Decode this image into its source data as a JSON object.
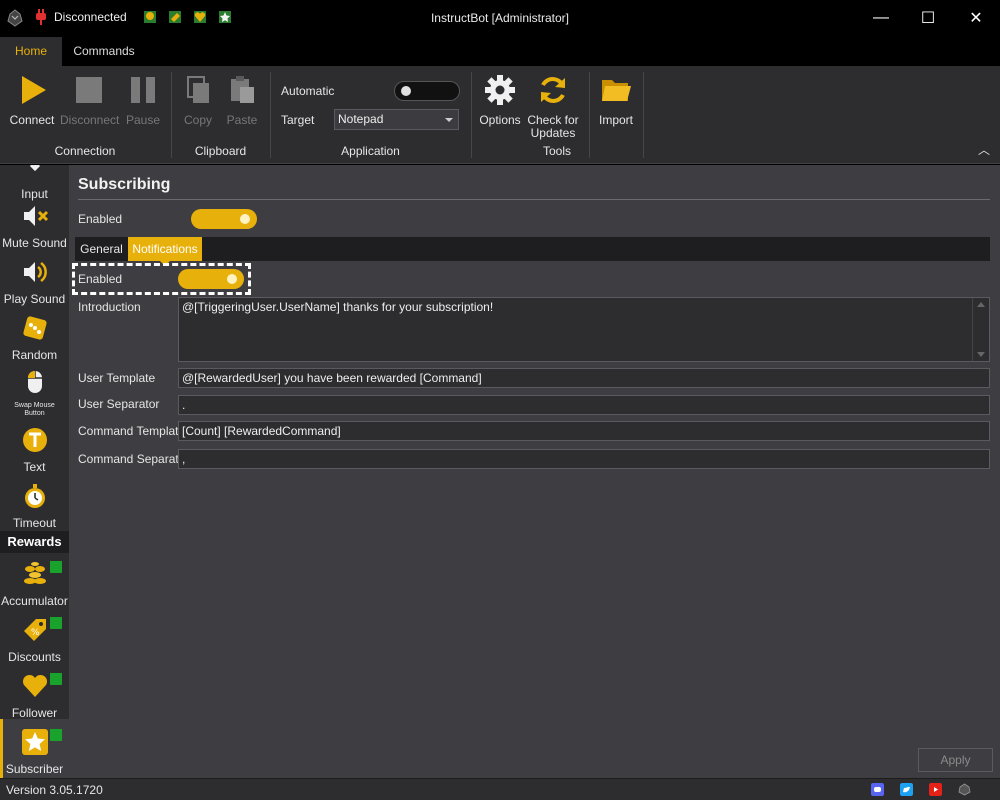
{
  "window": {
    "title": "InstructBot [Administrator]",
    "status": "Disconnected",
    "controls": {
      "minimize": "—",
      "maximize": "☐",
      "close": "✕"
    }
  },
  "menu_tabs": [
    {
      "label": "Home",
      "active": true
    },
    {
      "label": "Commands",
      "active": false
    }
  ],
  "ribbon": {
    "connection": {
      "group_label": "Connection",
      "connect": "Connect",
      "disconnect": "Disconnect",
      "pause": "Pause"
    },
    "clipboard": {
      "group_label": "Clipboard",
      "copy": "Copy",
      "paste": "Paste"
    },
    "application": {
      "group_label": "Application",
      "automatic_label": "Automatic",
      "automatic_on": false,
      "target_label": "Target",
      "target_value": "Notepad"
    },
    "tools": {
      "group_label": "Tools",
      "options": "Options",
      "check_updates_line1": "Check for",
      "check_updates_line2": "Updates"
    },
    "import": "Import"
  },
  "sidebar": {
    "items": [
      {
        "label": "Input",
        "icon": "input-icon"
      },
      {
        "label": "Mute Sound",
        "icon": "mute-sound-icon"
      },
      {
        "label": "Play Sound",
        "icon": "play-sound-icon"
      },
      {
        "label": "Random",
        "icon": "dice-icon"
      },
      {
        "label_line1": "Swap Mouse",
        "label_line2": "Button",
        "icon": "mouse-icon"
      },
      {
        "label": "Text",
        "icon": "text-icon"
      },
      {
        "label": "Timeout",
        "icon": "stopwatch-icon"
      }
    ],
    "rewards_header": "Rewards",
    "rewards": [
      {
        "label": "Accumulator",
        "icon": "coins-icon",
        "enabled": true
      },
      {
        "label": "Discounts",
        "icon": "discount-tag-icon",
        "enabled": true
      },
      {
        "label": "Follower",
        "icon": "heart-icon",
        "enabled": true
      },
      {
        "label": "Subscriber",
        "icon": "star-icon",
        "enabled": true,
        "selected": true
      }
    ]
  },
  "main": {
    "title": "Subscribing",
    "enabled_label": "Enabled",
    "enabled": true,
    "tabs": [
      {
        "label": "General",
        "active": false
      },
      {
        "label": "Notifications",
        "active": true
      }
    ],
    "notifications": {
      "enabled_label": "Enabled",
      "enabled": true,
      "introduction_label": "Introduction",
      "introduction_value": "@[TriggeringUser.UserName] thanks for your subscription!",
      "user_template_label": "User Template",
      "user_template_value": "@[RewardedUser] you have been rewarded [Command]",
      "user_separator_label": "User Separator",
      "user_separator_value": ".",
      "command_template_label": "Command Template",
      "command_template_value": "[Count] [RewardedCommand]",
      "command_separator_label": "Command Separator",
      "command_separator_value": ","
    },
    "apply": "Apply"
  },
  "statusbar": {
    "version": "Version 3.05.1720",
    "social": [
      "discord-icon",
      "twitter-icon",
      "youtube-icon",
      "instructbot-icon"
    ]
  },
  "colors": {
    "accent": "#e8b00b",
    "badge": "#19a22c",
    "background": "#3e3e42",
    "chrome": "#2d2d30"
  }
}
